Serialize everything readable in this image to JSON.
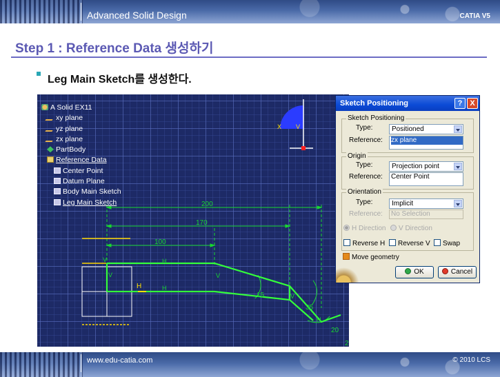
{
  "header": {
    "course_title": "Advanced Solid Design",
    "product": "CATIA V5"
  },
  "footer": {
    "url": "www.edu-catia.com",
    "copyright": "© 2010 LCS"
  },
  "slide": {
    "step_title": "Step 1 : Reference Data 생성하기",
    "bullet": "Leg Main Sketch를 생성한다."
  },
  "tree": {
    "items": [
      {
        "label": "A Solid EX11",
        "icon": "part-icon"
      },
      {
        "label": "xy plane",
        "icon": "plane-icon"
      },
      {
        "label": "yz plane",
        "icon": "plane-icon"
      },
      {
        "label": "zx plane",
        "icon": "plane-icon"
      },
      {
        "label": "PartBody",
        "icon": "body-icon"
      },
      {
        "label": "Reference Data",
        "icon": "geometrical-set-icon"
      },
      {
        "label": "Center Point",
        "icon": "sketch-icon"
      },
      {
        "label": "Datum Plane",
        "icon": "sketch-icon"
      },
      {
        "label": "Body Main Sketch",
        "icon": "sketch-icon"
      },
      {
        "label": "Leg Main Sketch",
        "icon": "sketch-icon"
      }
    ]
  },
  "viewport": {
    "dimensions": [
      "200",
      "170",
      "100",
      "15",
      "35",
      "20",
      "2"
    ],
    "constraint_labels": {
      "v": "V",
      "h": "H",
      "x": "X",
      "y": "V"
    }
  },
  "dialog": {
    "title": "Sketch Positioning",
    "help_glyph": "?",
    "close_glyph": "X",
    "sketch_positioning": {
      "group_label": "Sketch Positioning",
      "type_label": "Type:",
      "type_value": "Positioned",
      "reference_label": "Reference:",
      "reference_value": "zx plane"
    },
    "origin": {
      "group_label": "Origin",
      "type_label": "Type:",
      "type_value": "Projection point",
      "reference_label": "Reference:",
      "reference_value": "Center Point"
    },
    "orientation": {
      "group_label": "Orientation",
      "type_label": "Type:",
      "type_value": "Implicit",
      "reference_label": "Reference:",
      "reference_value": "No Selection",
      "h_direction": "H Direction",
      "v_direction": "V Direction",
      "reverse_h": "Reverse H",
      "reverse_v": "Reverse V",
      "swap": "Swap"
    },
    "move_geometry": "Move geometry",
    "ok_label": "OK",
    "cancel_label": "Cancel",
    "colors": {
      "titlebar": "#0b4ad6",
      "selection": "#316ac5"
    }
  },
  "colors": {
    "banner": "#3b5a98",
    "title": "#5b59b3",
    "viewport_bg": "#1d2a66",
    "sketch": "#34ff3a",
    "dimension": "#18d830"
  }
}
